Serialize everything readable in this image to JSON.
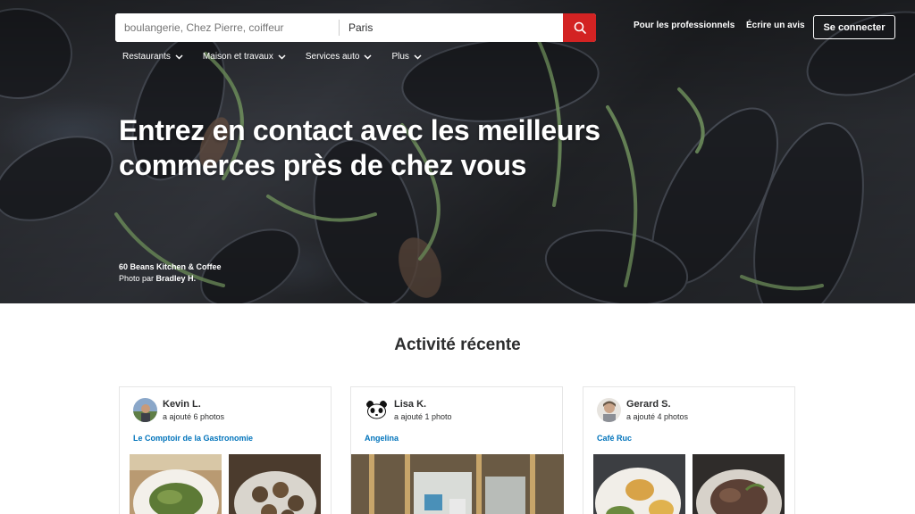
{
  "search": {
    "find_placeholder": "boulangerie, Chez Pierre, coiffeur",
    "near_value": "Paris",
    "button_icon": "search-icon"
  },
  "header": {
    "for_business": "Pour les professionnels",
    "write_review": "Écrire un avis",
    "login": "Se connecter"
  },
  "categories": [
    {
      "label": "Restaurants",
      "icon": "chevron-down-icon"
    },
    {
      "label": "Maison et travaux",
      "icon": "chevron-down-icon"
    },
    {
      "label": "Services auto",
      "icon": "chevron-down-icon"
    },
    {
      "label": "Plus",
      "icon": "chevron-down-icon"
    }
  ],
  "hero": {
    "headline_line1": "Entrez en contact avec les meilleurs",
    "headline_line2": "commerces près de chez vous",
    "credit_business": "60 Beans Kitchen & Coffee",
    "credit_prefix": "Photo par",
    "credit_author": "Bradley H."
  },
  "activity": {
    "title": "Activité récente",
    "cards": [
      {
        "user": "Kevin L.",
        "action": "a ajouté 6 photos",
        "business": "Le Comptoir de la Gastronomie"
      },
      {
        "user": "Lisa K.",
        "action": "a ajouté 1 photo",
        "business": "Angelina"
      },
      {
        "user": "Gerard S.",
        "action": "a ajouté 4 photos",
        "business": "Café Ruc"
      }
    ]
  },
  "colors": {
    "brand_red": "#d32323",
    "link_blue": "#0073bb",
    "text_dark": "#2d2e2f"
  }
}
